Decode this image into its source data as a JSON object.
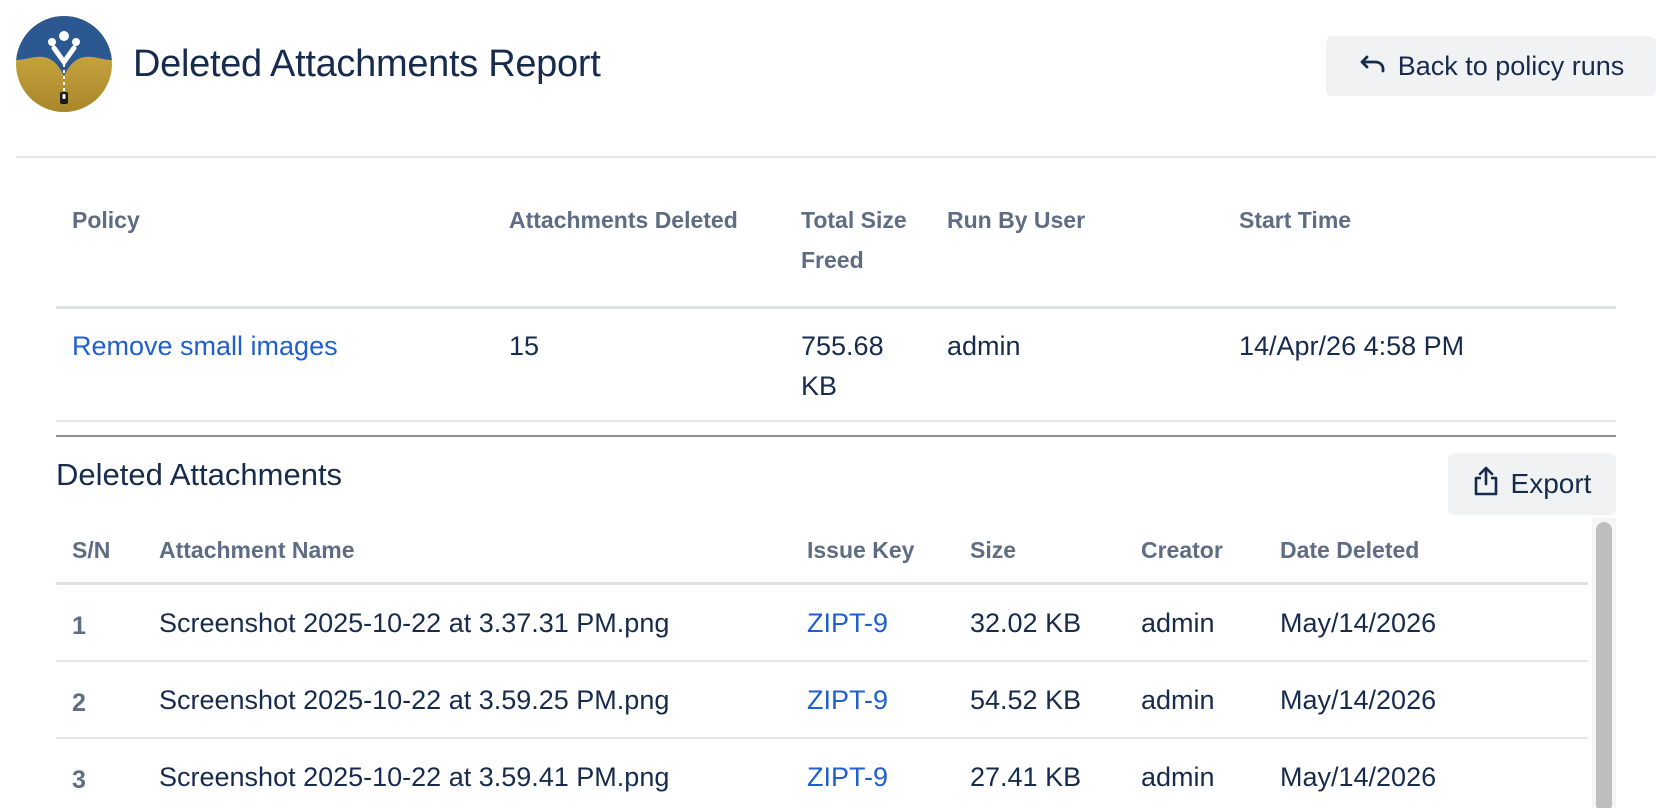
{
  "header": {
    "title": "Deleted Attachments Report",
    "back_label": "Back to policy runs",
    "logo_icon": "zipper-logo-icon"
  },
  "summary": {
    "columns": [
      "Policy",
      "Attachments Deleted",
      "Total Size Freed",
      "Run By User",
      "Start Time"
    ],
    "row": {
      "policy": "Remove small images",
      "attachments_deleted": "15",
      "total_size_freed": "755.68 KB",
      "run_by_user": "admin",
      "start_time": "14/Apr/26 4:58 PM"
    }
  },
  "deleted": {
    "title": "Deleted Attachments",
    "export_label": "Export",
    "columns": [
      "S/N",
      "Attachment Name",
      "Issue Key",
      "Size",
      "Creator",
      "Date Deleted"
    ],
    "rows": [
      {
        "sn": "1",
        "name": "Screenshot 2025-10-22 at 3.37.31 PM.png",
        "issue": "ZIPT-9",
        "size": "32.02 KB",
        "creator": "admin",
        "date": "May/14/2026"
      },
      {
        "sn": "2",
        "name": "Screenshot 2025-10-22 at 3.59.25 PM.png",
        "issue": "ZIPT-9",
        "size": "54.52 KB",
        "creator": "admin",
        "date": "May/14/2026"
      },
      {
        "sn": "3",
        "name": "Screenshot 2025-10-22 at 3.59.41 PM.png",
        "issue": "ZIPT-9",
        "size": "27.41 KB",
        "creator": "admin",
        "date": "May/14/2026"
      }
    ]
  },
  "colors": {
    "link": "#1f5fd1",
    "text": "#172b4d",
    "muted": "#5e6c84",
    "button_bg": "#f1f2f4",
    "logo_top": "#2b5891",
    "logo_bottom": "#c9a93a"
  }
}
